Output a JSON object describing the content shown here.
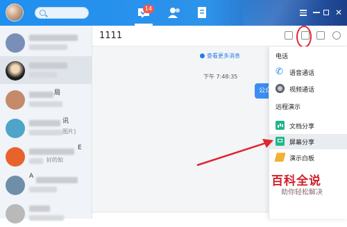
{
  "topbar": {
    "badge_count": "14"
  },
  "sidebar": {
    "items": [
      {
        "text": "",
        "sub": "",
        "avatar_color": "#7a8fb8"
      },
      {
        "text": "",
        "sub": "",
        "avatar_color": "#2b2b2b"
      },
      {
        "text": "局",
        "sub": "",
        "avatar_color": "#c48a6a"
      },
      {
        "text": "讯",
        "sub": "图片]",
        "avatar_color": "#4fa4c9"
      },
      {
        "text": "E",
        "sub": "好的知",
        "avatar_color": "#e8632c"
      },
      {
        "text": "A",
        "sub": "",
        "avatar_color": "#6f8fa8"
      },
      {
        "text": "",
        "sub": "",
        "avatar_color": "#b9b9b9"
      }
    ]
  },
  "chat": {
    "title": "1111",
    "more_messages": "查看更多消息",
    "timestamp": "下午 7:48:35",
    "bubble_text": "公众"
  },
  "menu": {
    "section_phone": "电话",
    "voice_call": "语音通话",
    "video_call": "视频通话",
    "section_remote": "远程演示",
    "doc_share": "文档分享",
    "screen_share": "屏幕分享",
    "whiteboard": "演示白板"
  },
  "watermark": {
    "logo": "百科全说",
    "tagline": "助你轻松解决"
  },
  "colors": {
    "accent": "#2c7be5",
    "annotation": "#e0262e"
  }
}
